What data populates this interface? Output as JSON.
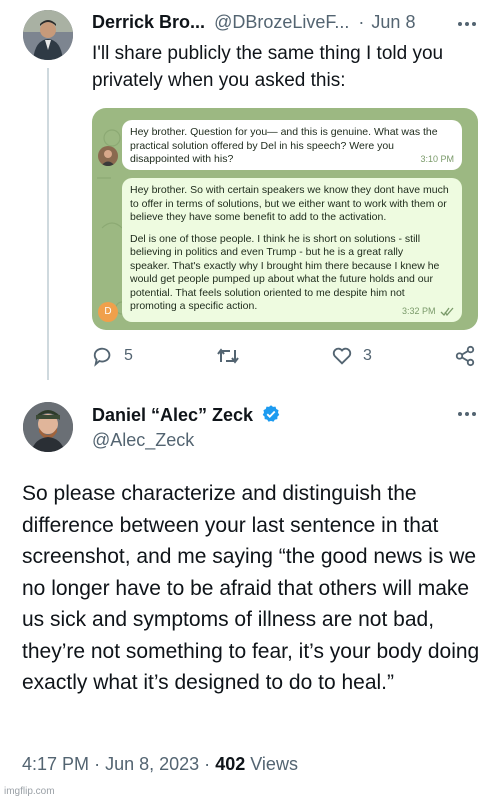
{
  "tweet1": {
    "display_name": "Derrick Bro...",
    "handle": "@DBrozeLiveF...",
    "separator": "·",
    "date": "Jun 8",
    "more_icon": "more-horizontal-icon",
    "text": "I'll share publicly the same thing I told you privately when you asked this:",
    "screenshot": {
      "message1": {
        "text": "Hey brother. Question for you— and this is genuine. What was the practical solution offered by Del in his speech? Were you disappointed with his?",
        "time": "3:10 PM"
      },
      "message2": {
        "paragraph1": "Hey brother. So with certain speakers we know they dont have much to offer in terms of solutions, but we either want to work with them or believe they have some benefit to add to the activation.",
        "paragraph2": "Del is one of those people. I think he is short on solutions - still believing in politics and even Trump - but he is a great rally speaker. That's exactly why I brought him there because I knew he would get people pumped up about what the future holds and our potential. That feels solution oriented to me despite him not promoting a specific action.",
        "time": "3:32 PM",
        "avatar_letter": "D"
      }
    },
    "actions": {
      "reply_count": "5",
      "retweet_count": "",
      "like_count": "3"
    }
  },
  "tweet2": {
    "display_name": "Daniel “Alec” Zeck",
    "handle": "@Alec_Zeck",
    "verified_icon": "verified-badge-icon",
    "text": "So please characterize and distinguish the difference between your last sentence in that screenshot, and me saying “the good news is we no longer have to be afraid that others will make us sick and symptoms of illness are not bad, they’re not something to fear, it’s your body doing exactly what it’s designed to do to heal.”",
    "time": "4:17 PM",
    "date": "Jun 8, 2023",
    "separator": "·",
    "views_count": "402",
    "views_label": "Views"
  },
  "watermark": "imgflip.com",
  "colors": {
    "text_primary": "#0f1419",
    "text_muted": "#536471",
    "verified_blue": "#1d9bf0",
    "chat_background": "#9cb882",
    "chat_bubble_incoming": "#eefbe0"
  }
}
